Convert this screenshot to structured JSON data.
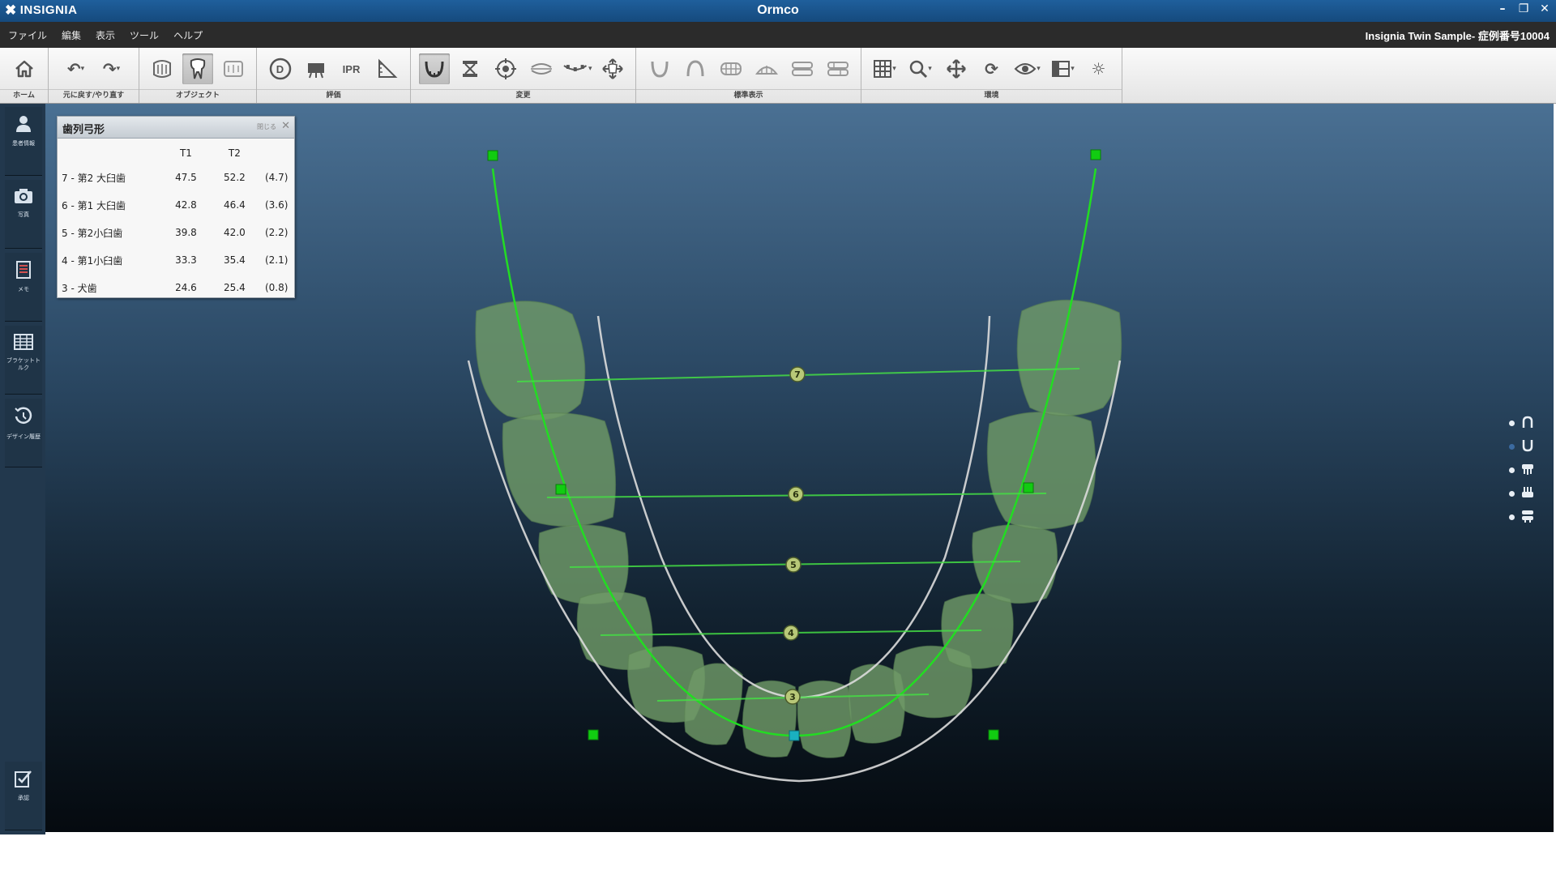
{
  "titlebar": {
    "logo": "INSIGNIA",
    "title": "Ormco",
    "minimize": "–",
    "restore": "❐",
    "close": "✕"
  },
  "menubar": {
    "items": [
      "ファイル",
      "編集",
      "表示",
      "ツール",
      "ヘルプ"
    ],
    "case_title": "Insignia Twin Sample- 症例番号10004"
  },
  "toolbar": {
    "groups": [
      {
        "label": "ホーム"
      },
      {
        "label": "元に戻す/やり直す"
      },
      {
        "label": "オブジェクト"
      },
      {
        "label": "評価"
      },
      {
        "label": "変更"
      },
      {
        "label": "標準表示"
      },
      {
        "label": "環境"
      }
    ],
    "text_buttons": {
      "d": "D",
      "ipr": "IPR"
    }
  },
  "leftbar": {
    "items": [
      {
        "icon": "person-icon",
        "label": "患者情報"
      },
      {
        "icon": "camera-icon",
        "label": "写真"
      },
      {
        "icon": "memo-icon",
        "label": "メモ"
      },
      {
        "icon": "bracket-table-icon",
        "label": "ブラケットトルク"
      },
      {
        "icon": "design-history-icon",
        "label": "デザイン履歴"
      },
      {
        "icon": "approve-icon",
        "label": "承認"
      }
    ]
  },
  "arch_panel": {
    "title": "歯列弓形",
    "collapse": "閉じる",
    "close": "✕",
    "headers": [
      "",
      "T1",
      "T2",
      ""
    ],
    "rows": [
      {
        "name": "7 - 第2 大臼歯",
        "t1": "47.5",
        "t2": "52.2",
        "diff": "(4.7)"
      },
      {
        "name": "6 - 第1 大臼歯",
        "t1": "42.8",
        "t2": "46.4",
        "diff": "(3.6)"
      },
      {
        "name": "5 - 第2小臼歯",
        "t1": "39.8",
        "t2": "42.0",
        "diff": "(2.2)"
      },
      {
        "name": "4 - 第1小臼歯",
        "t1": "33.3",
        "t2": "35.4",
        "diff": "(2.1)"
      },
      {
        "name": "3 - 犬歯",
        "t1": "24.6",
        "t2": "25.4",
        "diff": "(0.8)"
      }
    ]
  },
  "arch_markers": [
    "7",
    "6",
    "5",
    "4",
    "3"
  ],
  "right_controls": [
    {
      "icon": "upper-arch-icon",
      "active": true
    },
    {
      "icon": "lower-arch-icon",
      "active": false
    },
    {
      "icon": "upper-teeth-icon",
      "active": true
    },
    {
      "icon": "lower-teeth-icon",
      "active": true
    },
    {
      "icon": "both-teeth-icon",
      "active": true
    }
  ],
  "colors": {
    "arch_line": "#22dd22",
    "control_point": "#11cc11",
    "center_point": "#1ab0c0",
    "teeth": "#6f9a68",
    "outline": "#dcdcdc",
    "marker_fill": "#b8c878"
  }
}
